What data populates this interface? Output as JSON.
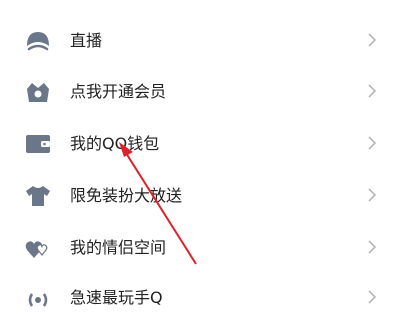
{
  "menu": {
    "items": [
      {
        "label": "直播",
        "icon": "live-icon"
      },
      {
        "label": "点我开通会员",
        "icon": "vip-icon"
      },
      {
        "label": "我的QQ钱包",
        "icon": "wallet-icon"
      },
      {
        "label": "限免装扮大放送",
        "icon": "shirt-icon"
      },
      {
        "label": "我的情侣空间",
        "icon": "couple-hearts-icon"
      },
      {
        "label": "急速最玩手Q",
        "icon": "broadcast-icon"
      }
    ]
  },
  "colors": {
    "icon": "#6b7689",
    "chevron": "#b3b7be",
    "text": "#222222",
    "arrow": "#e0202a",
    "background": "#ffffff"
  }
}
